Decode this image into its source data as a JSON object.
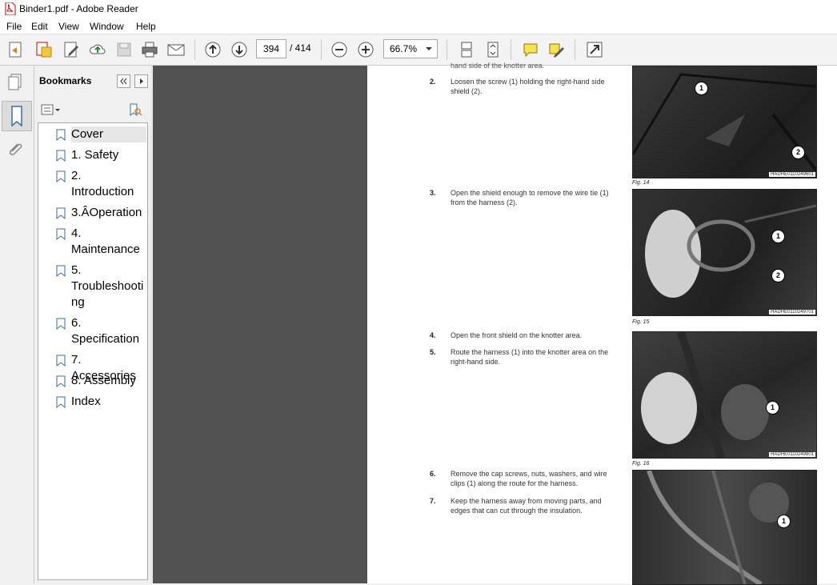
{
  "window": {
    "title": "Binder1.pdf - Adobe Reader"
  },
  "menu": [
    "File",
    "Edit",
    "View",
    "Window",
    "Help"
  ],
  "toolbar": {
    "current_page": "394",
    "total_pages": "/ 414",
    "zoom": "66.7%"
  },
  "bookmarks": {
    "title": "Bookmarks",
    "items": [
      {
        "label": "Cover"
      },
      {
        "label": "1. Safety"
      },
      {
        "label": "2. Introduction"
      },
      {
        "label": "3.ÂOperation"
      },
      {
        "label": "4. Maintenance"
      },
      {
        "label": "5. Troubleshooting"
      },
      {
        "label": "6. Specification"
      },
      {
        "label": "7. Accessories"
      },
      {
        "label": "8. Assembly"
      },
      {
        "label": "Index"
      }
    ]
  },
  "document": {
    "clipped_top": "hand side of the knotter area.",
    "steps": [
      {
        "num": "2.",
        "text": "Loosen the screw (1) holding the right-hand side shield (2)."
      },
      {
        "num": "3.",
        "text": "Open the shield enough to remove the wire tie (1) from the harness (2)."
      },
      {
        "num": "4.",
        "text": "Open the front shield on the knotter area."
      },
      {
        "num": "5.",
        "text": "Route the harness (1) into the knotter area on the right-hand side."
      },
      {
        "num": "6.",
        "text": "Remove the cap screws, nuts, washers, and wire clips (1) along the route for the harness."
      },
      {
        "num": "7.",
        "text": "Keep the harness away from moving parts, and edges that can cut through the insulation."
      }
    ],
    "figures": [
      {
        "code": "HADHE0110249601",
        "caption": "Fig. 14",
        "callouts": [
          "1",
          "2"
        ]
      },
      {
        "code": "HADHE0110249701",
        "caption": "Fig. 15",
        "callouts": [
          "1",
          "2"
        ]
      },
      {
        "code": "HADHE0110249801",
        "caption": "Fig. 16",
        "callouts": [
          "1"
        ]
      },
      {
        "code": "",
        "caption": "",
        "callouts": [
          "1"
        ]
      }
    ]
  }
}
